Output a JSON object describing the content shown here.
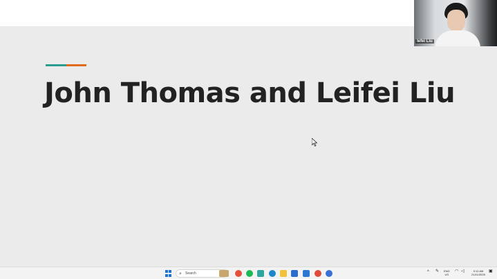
{
  "slide": {
    "title": "John Thomas and Leifei Liu",
    "accent_colors": [
      "#2a9d8f",
      "#e06a1a"
    ]
  },
  "video_tile": {
    "participant_name": "lefei Liu"
  },
  "taskbar": {
    "search_placeholder": "Search",
    "apps": [
      "file-manager-icon",
      "browser-red-icon",
      "spotify-icon",
      "app-teal-icon",
      "edge-icon",
      "file-explorer-icon",
      "outlook-icon",
      "app-blue-icon",
      "chrome-icon",
      "app-circle-icon"
    ],
    "tray": {
      "language": "ENG",
      "region": "US",
      "time": "9:12 AM",
      "date": "21/11/2025"
    }
  }
}
